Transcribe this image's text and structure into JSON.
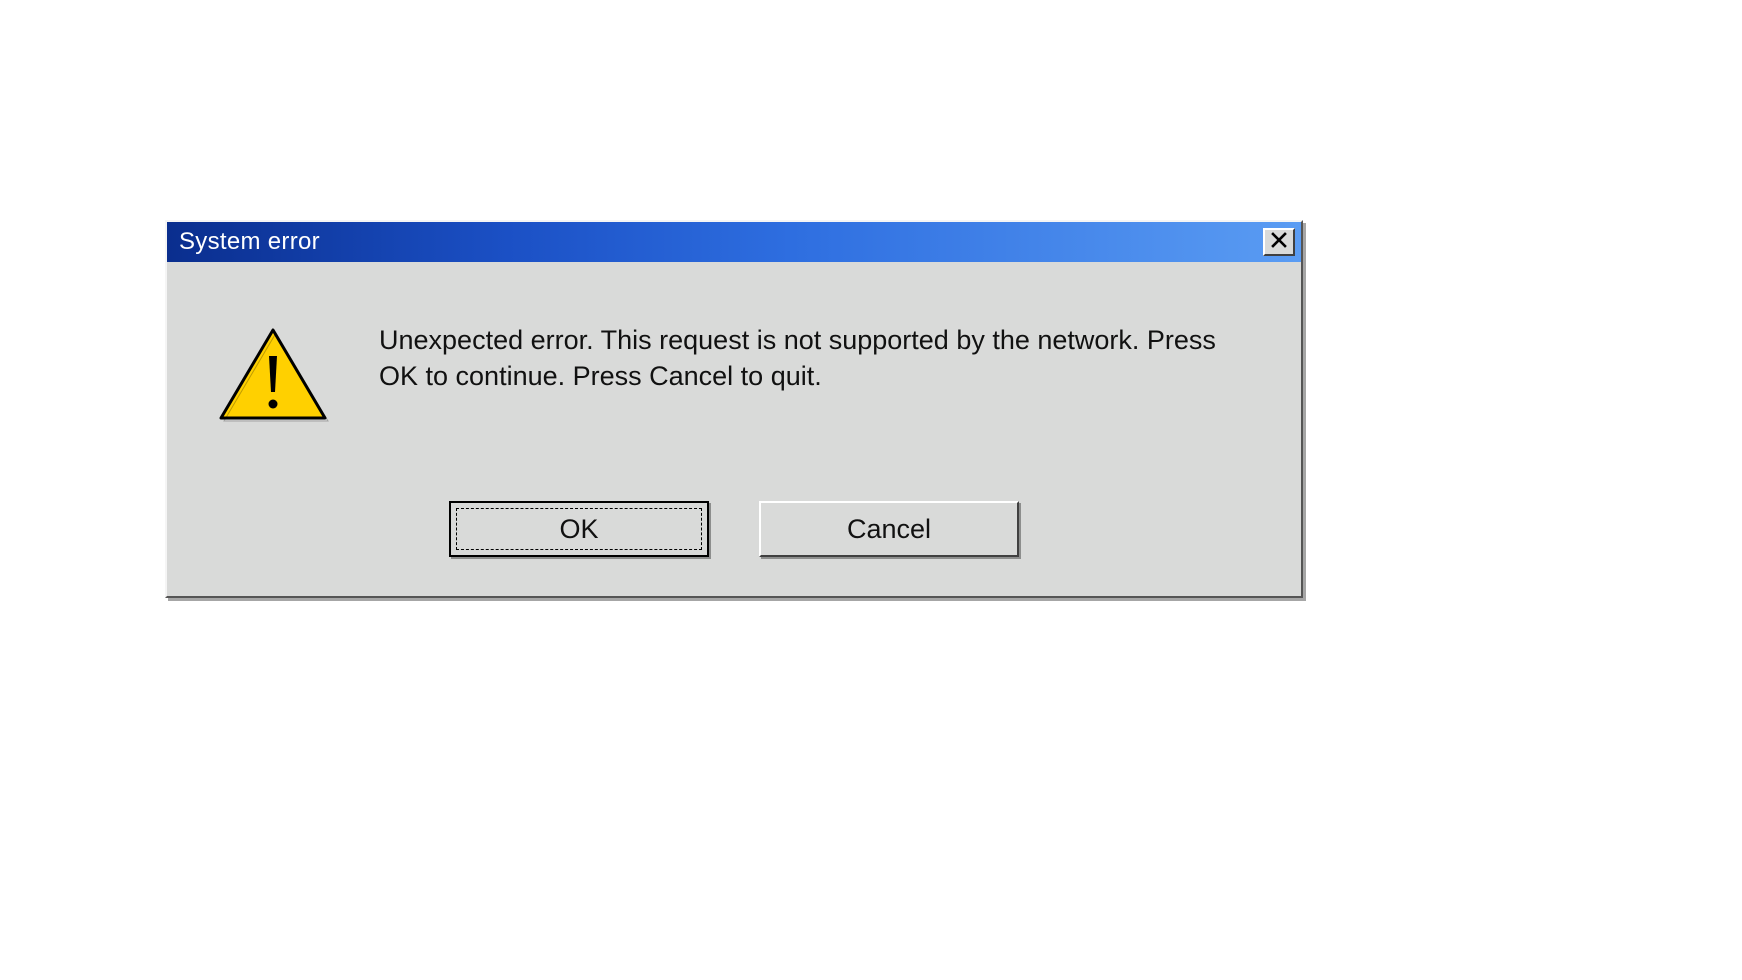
{
  "dialog": {
    "title": "System error",
    "message": "Unexpected error. This request is not supported by the network. Press OK to continue. Press Cancel to quit.",
    "buttons": {
      "ok": "OK",
      "cancel": "Cancel"
    },
    "icon": "warning-icon"
  }
}
